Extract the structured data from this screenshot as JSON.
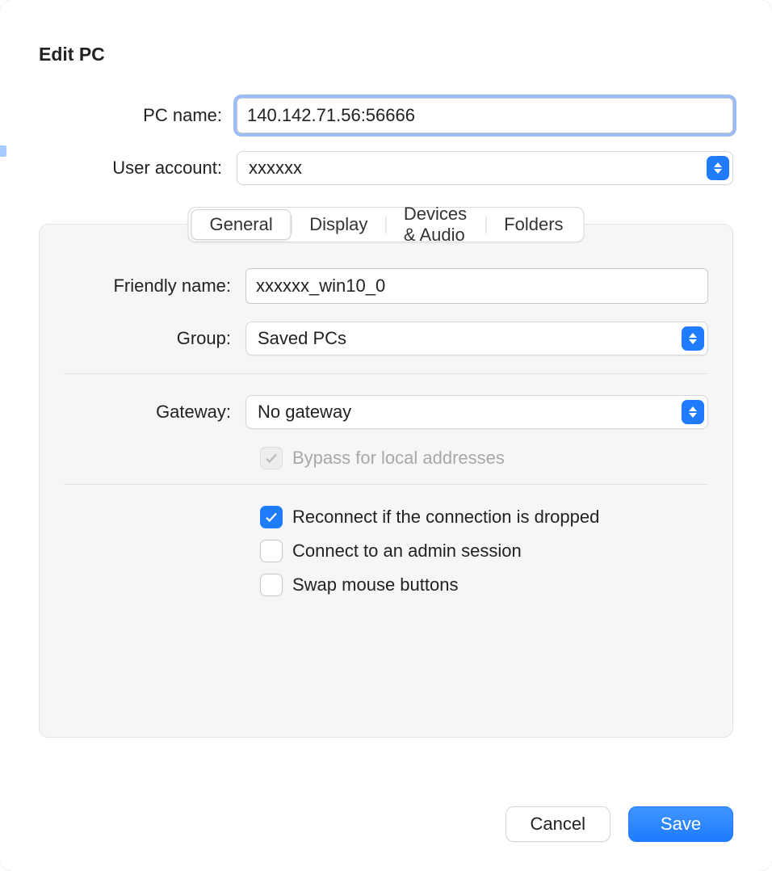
{
  "title": "Edit PC",
  "form": {
    "pc_name_label": "PC name:",
    "pc_name_value": "140.142.71.56:56666",
    "user_account_label": "User account:",
    "user_account_value": "xxxxxx"
  },
  "tabs": {
    "general": "General",
    "display": "Display",
    "devices": "Devices & Audio",
    "folders": "Folders"
  },
  "general": {
    "friendly_name_label": "Friendly name:",
    "friendly_name_value": "xxxxxx_win10_0",
    "group_label": "Group:",
    "group_value": "Saved PCs",
    "gateway_label": "Gateway:",
    "gateway_value": "No gateway",
    "bypass_label": "Bypass for local addresses",
    "reconnect_label": "Reconnect if the connection is dropped",
    "admin_label": "Connect to an admin session",
    "swap_label": "Swap mouse buttons"
  },
  "buttons": {
    "cancel": "Cancel",
    "save": "Save"
  }
}
